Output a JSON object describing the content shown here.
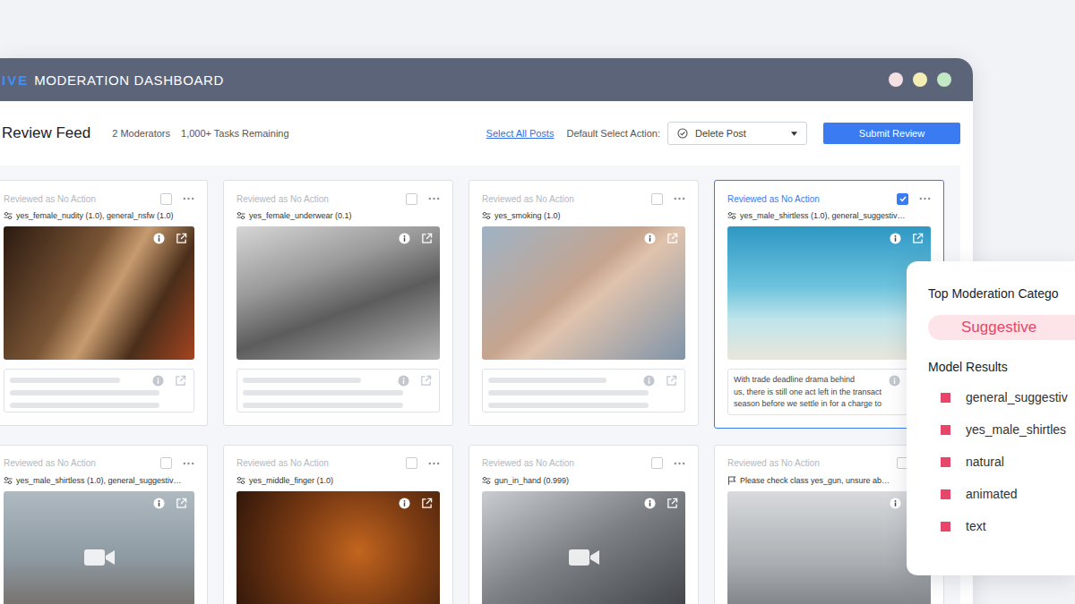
{
  "window": {
    "brand": "IVE",
    "title": "MODERATION DASHBOARD"
  },
  "toolbar": {
    "title": "Review Feed",
    "moderators": "2 Moderators",
    "tasks": "1,000+ Tasks Remaining",
    "select_all": "Select All Posts",
    "default_action_label": "Default Select Action:",
    "default_action": "Delete Post",
    "submit": "Submit Review"
  },
  "posts": [
    {
      "status": "Reviewed as No Action",
      "selected": false,
      "label_kind": "model",
      "labels": "yes_female_nudity (1.0), general_nsfw (1.0)",
      "media": "image",
      "caption_kind": "skeleton"
    },
    {
      "status": "Reviewed as No Action",
      "selected": false,
      "label_kind": "model",
      "labels": "yes_female_underwear (0.1)",
      "media": "image",
      "caption_kind": "skeleton"
    },
    {
      "status": "Reviewed as No Action",
      "selected": false,
      "label_kind": "model",
      "labels": "yes_smoking (1.0)",
      "media": "image",
      "caption_kind": "skeleton"
    },
    {
      "status": "Reviewed as No Action",
      "selected": true,
      "label_kind": "model",
      "labels": "yes_male_shirtless (1.0), general_suggestiv…",
      "media": "image",
      "caption_kind": "text",
      "caption": [
        "With trade deadline drama behind",
        "us, there is still one act left in the transact",
        "season before we settle in for a charge to"
      ]
    },
    {
      "status": "Reviewed as No Action",
      "selected": false,
      "label_kind": "model",
      "labels": "yes_male_shirtless (1.0), general_suggestiv…",
      "media": "video",
      "caption_kind": "none"
    },
    {
      "status": "Reviewed as No Action",
      "selected": false,
      "label_kind": "model",
      "labels": "yes_middle_finger (1.0)",
      "media": "image",
      "caption_kind": "none"
    },
    {
      "status": "Reviewed as No Action",
      "selected": false,
      "label_kind": "model",
      "labels": "gun_in_hand (0.999)",
      "media": "video",
      "caption_kind": "none"
    },
    {
      "status": "Reviewed as No Action",
      "selected": false,
      "label_kind": "flag",
      "labels": "Please check class yes_gun, unsure ab…",
      "media": "image",
      "caption_kind": "none"
    }
  ],
  "details": {
    "title": "Top Moderation Catego",
    "category": "Suggestive",
    "results_title": "Model Results",
    "results": [
      "general_suggestiv",
      "yes_male_shirtles",
      "natural",
      "animated",
      "text"
    ]
  }
}
